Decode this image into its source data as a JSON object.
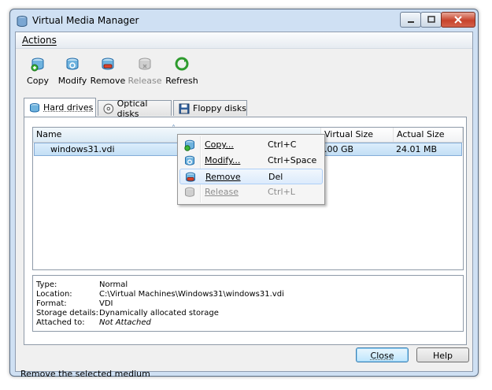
{
  "window": {
    "title": "Virtual Media Manager"
  },
  "menubar": {
    "actions": "Actions"
  },
  "toolbar": [
    {
      "label": "Copy",
      "icon": "copy-disk-icon",
      "enabled": true
    },
    {
      "label": "Modify",
      "icon": "modify-disk-icon",
      "enabled": true
    },
    {
      "label": "Remove",
      "icon": "remove-disk-icon",
      "enabled": true
    },
    {
      "label": "Release",
      "icon": "release-disk-icon",
      "enabled": false
    },
    {
      "label": "Refresh",
      "icon": "refresh-icon",
      "enabled": true
    }
  ],
  "tabs": [
    {
      "label": "Hard drives",
      "icon": "hard-drive-icon",
      "active": true
    },
    {
      "label": "Optical disks",
      "icon": "optical-disk-icon",
      "active": false
    },
    {
      "label": "Floppy disks",
      "icon": "floppy-disk-icon",
      "active": false
    }
  ],
  "list": {
    "columns": [
      "Name",
      "Virtual Size",
      "Actual Size"
    ],
    "sort_indicator": "˄",
    "rows": [
      {
        "name": "windows31.vdi",
        "virtual_size": ".00 GB",
        "actual_size": "24.01 MB"
      }
    ]
  },
  "details": [
    {
      "label": "Type:",
      "value": "Normal"
    },
    {
      "label": "Location:",
      "value": "C:\\Virtual Machines\\Windows31\\windows31.vdi"
    },
    {
      "label": "Format:",
      "value": "VDI"
    },
    {
      "label": "Storage details:",
      "value": "Dynamically allocated storage"
    },
    {
      "label": "Attached to:",
      "value": "Not Attached"
    }
  ],
  "buttons": {
    "close": "Close",
    "help": "Help"
  },
  "status": "Remove the selected medium",
  "context_menu": [
    {
      "label": "Copy...",
      "shortcut": "Ctrl+C",
      "icon": "copy-disk-icon",
      "enabled": true,
      "highlighted": false
    },
    {
      "label": "Modify...",
      "shortcut": "Ctrl+Space",
      "icon": "modify-disk-icon",
      "enabled": true,
      "highlighted": false
    },
    {
      "label": "Remove",
      "shortcut": "Del",
      "icon": "remove-disk-icon",
      "enabled": true,
      "highlighted": true
    },
    {
      "label": "Release",
      "shortcut": "Ctrl+L",
      "icon": "release-disk-icon",
      "enabled": false,
      "highlighted": false
    }
  ],
  "colors": {
    "accent": "#3c7fb1",
    "selection": "#c3dff5",
    "title_bar": "#cfe0f3"
  }
}
